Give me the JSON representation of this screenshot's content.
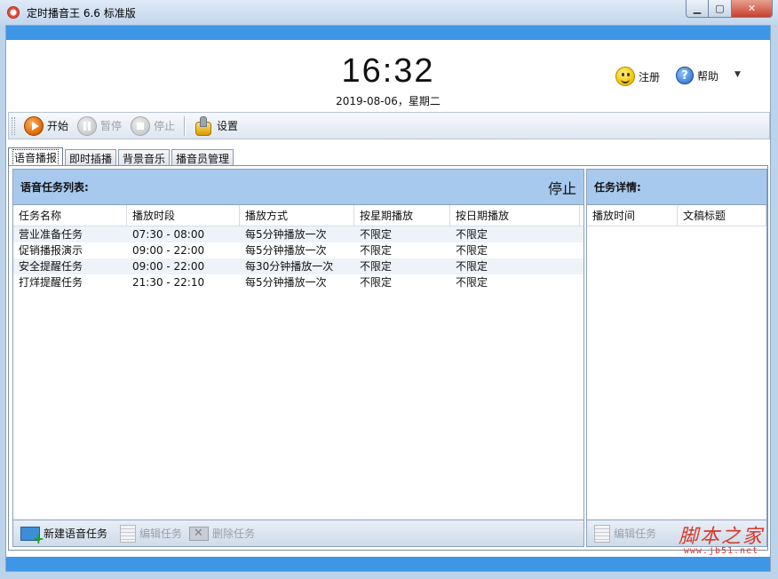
{
  "window": {
    "title": "定时播音王 6.6 标准版",
    "min_glyph": "▁",
    "max_glyph": "▢",
    "close_glyph": "✕"
  },
  "header": {
    "time": "16:32",
    "date": "2019-08-06，星期二",
    "register_label": "注册",
    "help_label": "帮助",
    "help_glyph": "?",
    "dropdown_glyph": "▼"
  },
  "toolbar": {
    "start_label": "开始",
    "pause_label": "暂停",
    "stop_label": "停止",
    "settings_label": "设置"
  },
  "tabs": [
    "语音播报",
    "即时插播",
    "背景音乐",
    "播音员管理"
  ],
  "task_list": {
    "title": "语音任务列表:",
    "status": "停止",
    "columns": [
      "任务名称",
      "播放时段",
      "播放方式",
      "按星期播放",
      "按日期播放"
    ],
    "rows": [
      [
        "营业准备任务",
        "07:30 - 08:00",
        "每5分钟播放一次",
        "不限定",
        "不限定"
      ],
      [
        "促销播报演示",
        "09:00 - 22:00",
        "每5分钟播放一次",
        "不限定",
        "不限定"
      ],
      [
        "安全提醒任务",
        "09:00 - 22:00",
        "每30分钟播放一次",
        "不限定",
        "不限定"
      ],
      [
        "打烊提醒任务",
        "21:30 - 22:10",
        "每5分钟播放一次",
        "不限定",
        "不限定"
      ]
    ],
    "new_label": "新建语音任务",
    "edit_label": "编辑任务",
    "delete_label": "删除任务"
  },
  "task_detail": {
    "title": "任务详情:",
    "columns": [
      "播放时间",
      "文稿标题"
    ],
    "edit_label": "编辑任务"
  },
  "watermark": {
    "main": "脚本之家",
    "sub": "www.jb51.net"
  }
}
